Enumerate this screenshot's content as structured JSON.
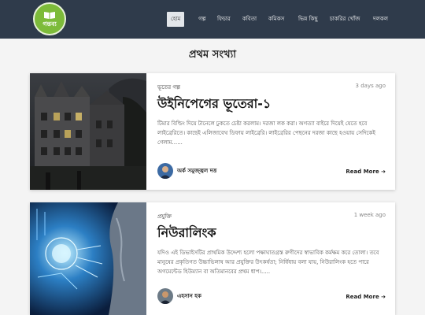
{
  "header": {
    "logo_text": "গন্তব্য",
    "nav": [
      {
        "label": "হোম",
        "active": true
      },
      {
        "label": "গল্প"
      },
      {
        "label": "ফিচার"
      },
      {
        "label": "কবিতা"
      },
      {
        "label": "কমিকস"
      },
      {
        "label": "ভিন্ন কিছু"
      },
      {
        "label": "চাকরির খোঁজ"
      },
      {
        "label": "দলকল"
      }
    ]
  },
  "page_title": "প্রথম সংখ্যা",
  "posts": [
    {
      "category": "ভূতের গল্প",
      "time": "3 days ago",
      "title": "উইনিপেগের ভূতেরা-১",
      "excerpt": "টিমার বিল্ডিং দিয়ে টানেলে ঢুকতে চেষ্টা করলাম। দরজা লক করা। অগত্যা বাইরে দিয়েই যেতে হবে লাইব্রেরিতে। কাছেই এলিজাবেথ ডিফায় লাইব্রেরি। লাইব্রেরির পেছনের দরজা কাছে হওয়ায় সেদিকেই গেলাম......",
      "author": "অর্ক সমুজ্জ্বল দত্ত",
      "read_more": "Read More ➔"
    },
    {
      "category": "প্রযুক্তি",
      "time": "1 week ago",
      "title": "নিউরালিংক",
      "excerpt": "যদিও এই ডিভাইসটির প্রাথমিক উদ্দেশ্য হলো পক্ষাঘাতগ্রস্ত রুগীদের স্বাভাবিক কর্মক্ষম করে তোলা। তবে মানুষের প্রকৃতিগত উচ্চাভিলাষ আর প্রযুক্তির উৎকর্ষতা; নির্ধিধায় বলা যায়, নিউরালিংক হতে পারে অগমেন্টেড হিউম্যান বা অতিমানবের প্রথম ধাপ।.....",
      "author": "এহসান হক",
      "read_more": "Read More ➔"
    }
  ]
}
